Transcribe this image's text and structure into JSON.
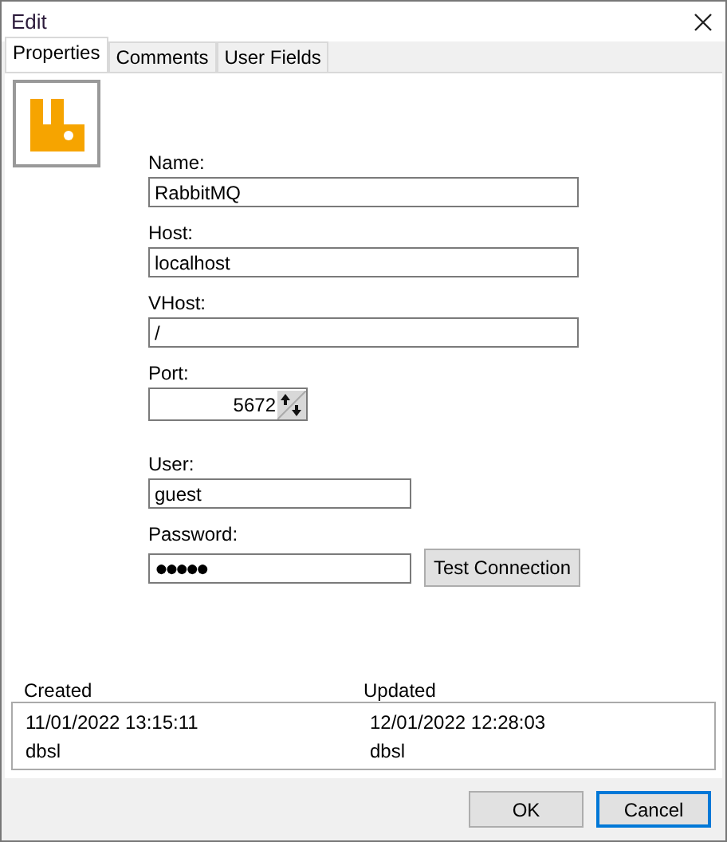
{
  "window": {
    "title": "Edit"
  },
  "tabs": [
    {
      "label": "Properties",
      "selected": true
    },
    {
      "label": "Comments",
      "selected": false
    },
    {
      "label": "User Fields",
      "selected": false
    }
  ],
  "fields": [
    {
      "kind": "text",
      "label": "Name:",
      "value": "RabbitMQ"
    },
    {
      "kind": "text",
      "label": "Host:",
      "value": "localhost"
    },
    {
      "kind": "text",
      "label": "VHost:",
      "value": "/"
    },
    {
      "kind": "number",
      "label": "Port:",
      "value": "5672"
    },
    {
      "kind": "short",
      "label": "User:",
      "value": "guest"
    },
    {
      "kind": "password",
      "label": "Password:",
      "value": "●●●●●",
      "button": "Test Connection"
    }
  ],
  "audit": {
    "columns": [
      "Created",
      "Updated"
    ],
    "rows": [
      [
        "11/01/2022 13:15:11",
        "12/01/2022 12:28:03"
      ],
      [
        "dbsl",
        "dbsl"
      ]
    ]
  },
  "buttons": [
    {
      "label": "OK",
      "default": false
    },
    {
      "label": "Cancel",
      "default": true
    }
  ]
}
